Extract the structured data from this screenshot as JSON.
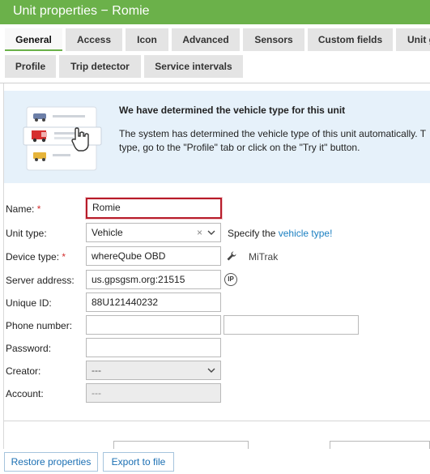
{
  "window": {
    "title": "Unit properties − Romie"
  },
  "tabs": {
    "general": "General",
    "access": "Access",
    "icon": "Icon",
    "advanced": "Advanced",
    "sensors": "Sensors",
    "custom_fields": "Custom fields",
    "unit_groups_partial": "Unit g",
    "profile": "Profile",
    "trip_detector": "Trip detector",
    "service_intervals": "Service intervals",
    "active": "General"
  },
  "banner": {
    "title": "We have determined the vehicle type for this unit",
    "text": "The system has determined the vehicle type of this unit automatically. T type, go to the \"Profile\" tab or click on the \"Try it\" button."
  },
  "form": {
    "required_mark": "*",
    "name": {
      "label": "Name:",
      "value": "Romie"
    },
    "unit_type": {
      "label": "Unit type:",
      "value": "Vehicle",
      "clear": "×",
      "hint_prefix": "Specify the",
      "hint_link": "vehicle type!"
    },
    "device_type": {
      "label": "Device type:",
      "value": "whereQube OBD",
      "vendor": "MiTrak"
    },
    "server_address": {
      "label": "Server address:",
      "value": "us.gpsgsm.org:21515",
      "icon_text": "IP"
    },
    "unique_id": {
      "label": "Unique ID:",
      "value": "88U121440232"
    },
    "phone_number": {
      "label": "Phone number:",
      "value": "",
      "value2": ""
    },
    "password": {
      "label": "Password:",
      "value": ""
    },
    "creator": {
      "label": "Creator:",
      "value": "---"
    },
    "account": {
      "label": "Account:",
      "value": "---"
    }
  },
  "footer": {
    "restore": "Restore properties",
    "export": "Export to file"
  },
  "colors": {
    "titlebar": "#6bb14a",
    "banner_bg": "#e6f1fa",
    "link": "#1a7fc1",
    "required": "#d32f2f",
    "focus_border": "#b71c2a"
  },
  "icons": [
    "wrench-icon",
    "ip-icon",
    "chevron-down-icon",
    "clear-icon",
    "vehicle-type-illustration"
  ]
}
